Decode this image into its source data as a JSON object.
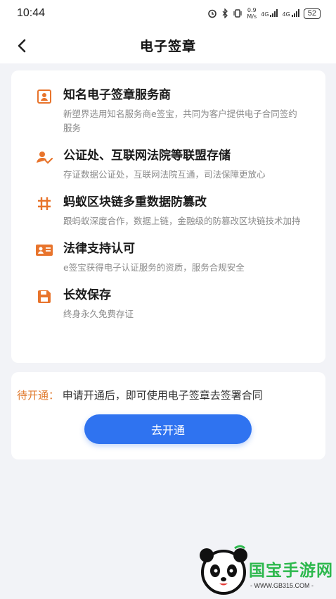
{
  "status_bar": {
    "time": "10:44",
    "speed": "0.9",
    "speed_unit": "M/s",
    "net1": "4G",
    "net2": "4G",
    "battery": "52"
  },
  "nav": {
    "title": "电子签章",
    "back_icon": "chevron-left-icon"
  },
  "features": [
    {
      "title": "知名电子签章服务商",
      "desc": "新塑界选用知名服务商e签宝，共同为客户提供电子合同签约服务",
      "icon": "certificate-icon"
    },
    {
      "title": "公证处、互联网法院等联盟存储",
      "desc": "存证数据公证处，互联网法院互通，司法保障更放心",
      "icon": "user-check-icon"
    },
    {
      "title": "蚂蚁区块链多重数据防篡改",
      "desc": "跟蚂蚁深度合作，数据上链，金融级的防篡改区块链技术加持",
      "icon": "hash-grid-icon"
    },
    {
      "title": "法律支持认可",
      "desc": "e签宝获得电子认证服务的资质，服务合规安全",
      "icon": "id-card-icon"
    },
    {
      "title": "长效保存",
      "desc": "终身永久免费存证",
      "icon": "save-disk-icon"
    }
  ],
  "open": {
    "status_label": "待开通：",
    "text": "申请开通后，即可使用电子签章去签署合同",
    "button_label": "去开通"
  },
  "watermark": {
    "logo_text": "国宝手游网",
    "url": "- WWW.GB315.COM -"
  },
  "colors": {
    "accent": "#2f73f0",
    "icon_orange": "#e8742c",
    "status_orange": "#e07a2e",
    "background": "#f2f3f7"
  }
}
